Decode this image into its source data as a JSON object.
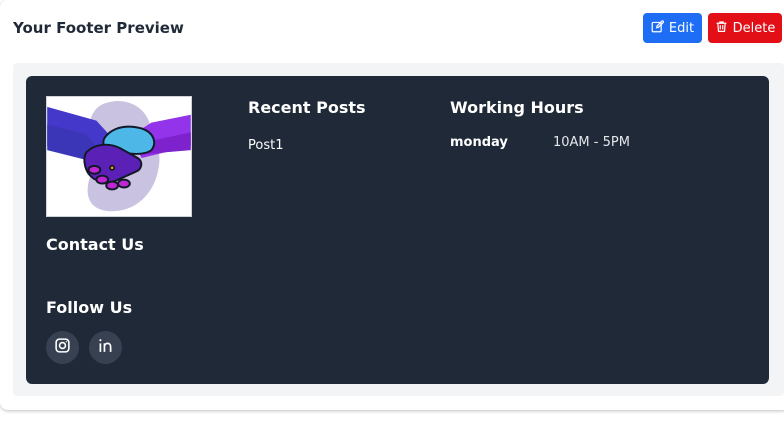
{
  "header": {
    "title": "Your Footer Preview",
    "edit_label": "Edit",
    "delete_label": "Delete"
  },
  "footer": {
    "contact_heading": "Contact Us",
    "follow_heading": "Follow Us",
    "recent_posts": {
      "heading": "Recent Posts",
      "items": [
        "Post1"
      ]
    },
    "working_hours": {
      "heading": "Working Hours",
      "rows": [
        {
          "day": "monday",
          "time": "10AM - 5PM"
        }
      ]
    },
    "social_icons": [
      "instagram-icon",
      "linkedin-icon"
    ],
    "logo_icon": "handshake-logo"
  },
  "colors": {
    "edit_button": "#1d6ef5",
    "delete_button": "#e20f17",
    "footer_background": "#1f2937",
    "preview_background": "#f3f4f6"
  }
}
